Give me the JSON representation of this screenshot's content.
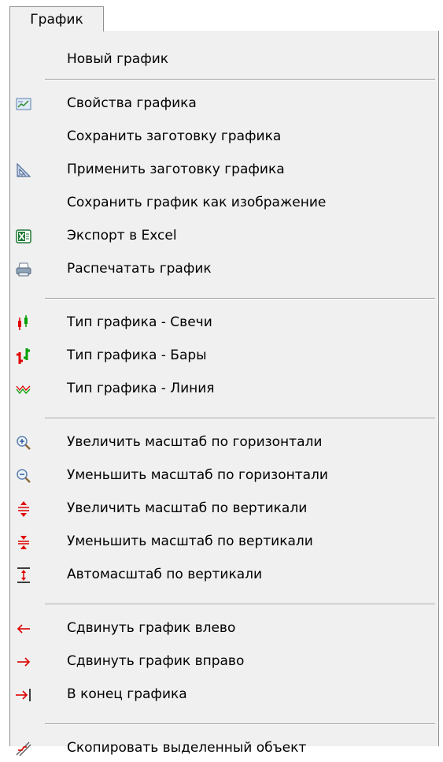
{
  "menubar": {
    "title": "График"
  },
  "menu": {
    "items": [
      {
        "label": "Новый график",
        "icon": "none"
      },
      {
        "label": "Свойства графика",
        "icon": "chart-properties-icon"
      },
      {
        "label": "Сохранить заготовку графика",
        "icon": "none"
      },
      {
        "label": "Применить заготовку графика",
        "icon": "set-square-icon"
      },
      {
        "label": "Сохранить график как изображение",
        "icon": "none"
      },
      {
        "label": "Экспорт в Excel",
        "icon": "excel-icon"
      },
      {
        "label": "Распечатать график",
        "icon": "printer-icon"
      },
      {
        "label": "Тип графика - Свечи",
        "icon": "candles-icon"
      },
      {
        "label": "Тип графика - Бары",
        "icon": "bars-icon"
      },
      {
        "label": "Тип графика - Линия",
        "icon": "line-chart-icon"
      },
      {
        "label": "Увеличить масштаб по горизонтали",
        "icon": "zoom-in-icon"
      },
      {
        "label": "Уменьшить масштаб по горизонтали",
        "icon": "zoom-out-icon"
      },
      {
        "label": "Увеличить масштаб по вертикали",
        "icon": "vertical-expand-icon"
      },
      {
        "label": "Уменьшить масштаб по вертикали",
        "icon": "vertical-shrink-icon"
      },
      {
        "label": "Автомасштаб по вертикали",
        "icon": "auto-scale-icon"
      },
      {
        "label": "Сдвинуть график влево",
        "icon": "arrow-left-icon"
      },
      {
        "label": "Сдвинуть график вправо",
        "icon": "arrow-right-icon"
      },
      {
        "label": "В конец графика",
        "icon": "arrow-to-end-icon"
      },
      {
        "label": "Скопировать выделенный объект",
        "icon": "copy-object-icon"
      }
    ]
  },
  "colors": {
    "menu_bg": "#f0f0f0",
    "separator": "#a0a0a0",
    "icon_red": "#e00000",
    "icon_green": "#00a000"
  }
}
